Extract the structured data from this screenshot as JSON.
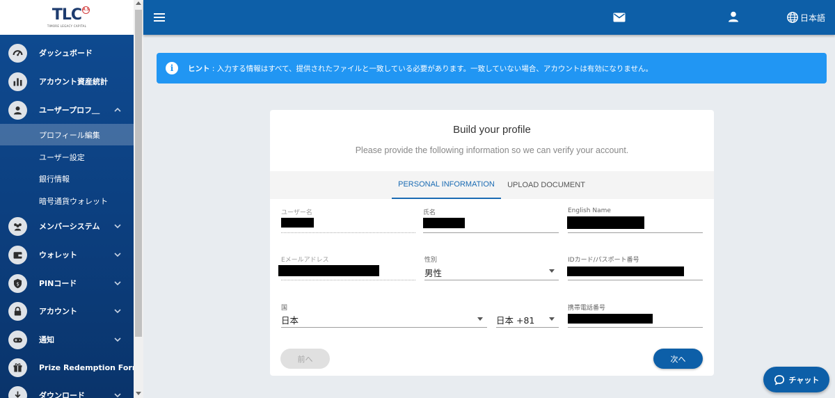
{
  "brand": {
    "logo_text": "TLC",
    "logo_badge": "R.S",
    "logo_subtitle": "TIMORE LEGACY CAPITAL"
  },
  "sidebar": {
    "items": [
      {
        "label": "ダッシュボード",
        "icon": "speedometer-icon"
      },
      {
        "label": "アカウント資産統計",
        "icon": "bar-chart-icon"
      },
      {
        "label": "ユーザープロフ＿",
        "icon": "user-icon",
        "expanded": true
      },
      {
        "label": "メンバーシステム",
        "icon": "members-icon"
      },
      {
        "label": "ウォレット",
        "icon": "wallet-icon"
      },
      {
        "label": "PINコード",
        "icon": "pin-shield-icon"
      },
      {
        "label": "アカウント",
        "icon": "lock-icon"
      },
      {
        "label": "通知",
        "icon": "gamepad-icon"
      },
      {
        "label": "Prize Redemption Form",
        "icon": "prize-icon"
      },
      {
        "label": "ダウンロード",
        "icon": "download-icon"
      }
    ],
    "subitems": [
      {
        "label": "プロフィール編集",
        "active": true
      },
      {
        "label": "ユーザー設定",
        "active": false
      },
      {
        "label": "銀行情報",
        "active": false
      },
      {
        "label": "暗号通貨ウォレット",
        "active": false
      }
    ]
  },
  "topbar": {
    "language": "日本語"
  },
  "hint": {
    "strong": "ヒント",
    "text": " : 入力する情報はすべて、提供されたファイルと一致している必要があります。一致していない場合、アカウントは有効になりません。"
  },
  "card": {
    "title": "Build your profile",
    "subtitle": "Please provide the following information so we can verify your account.",
    "tabs": [
      "PERSONAL INFORMATION",
      "UPLOAD DOCUMENT"
    ],
    "fields": {
      "username_label": "ユーザー名",
      "name_label": "氏名",
      "english_name_label": "English Name",
      "email_label": "Eメールアドレス",
      "gender_label": "性別",
      "gender_value": "男性",
      "id_label": "IDカード/パスポート番号",
      "country_label": "国",
      "country_value": "日本",
      "phone_code_value": "日本 +81",
      "phone_label": "携帯電話番号"
    },
    "prev_label": "前へ",
    "next_label": "次へ"
  },
  "chat": {
    "label": "チャット"
  },
  "colors": {
    "primary": "#0d5fa8",
    "hint": "#2196f3",
    "sidebar": "#0f4c93"
  }
}
